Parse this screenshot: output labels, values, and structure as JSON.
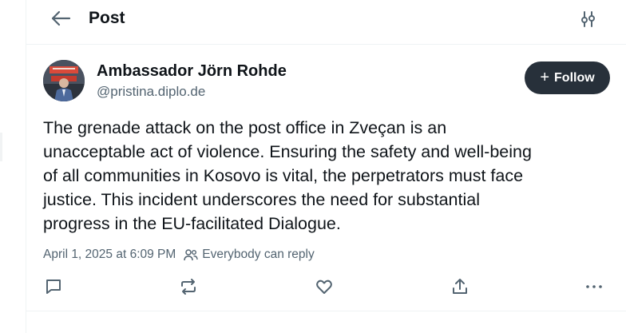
{
  "header": {
    "title": "Post",
    "back_icon": "arrow-left-icon",
    "filter_icon": "sliders-icon"
  },
  "post": {
    "author_name": "Ambassador Jörn Rohde",
    "author_handle": "@pristina.diplo.de",
    "follow_label": "Follow",
    "text": "The grenade attack on the post office in Zveçan is an\nunacceptable act of violence. Ensuring the safety and well-being\nof all communities in Kosovo is vital, the perpetrators must face\njustice. This incident underscores the need for substantial\nprogress in the EU-facilitated Dialogue.",
    "timestamp": "April 1, 2025 at 6:09 PM",
    "reply_setting": "Everybody can reply"
  },
  "actions": [
    "reply-icon",
    "repost-icon",
    "like-icon",
    "share-icon",
    "more-icon"
  ],
  "colors": {
    "text": "#0f1419",
    "muted": "#536471",
    "follow_bg": "#27303a",
    "border": "#eff3f4"
  }
}
